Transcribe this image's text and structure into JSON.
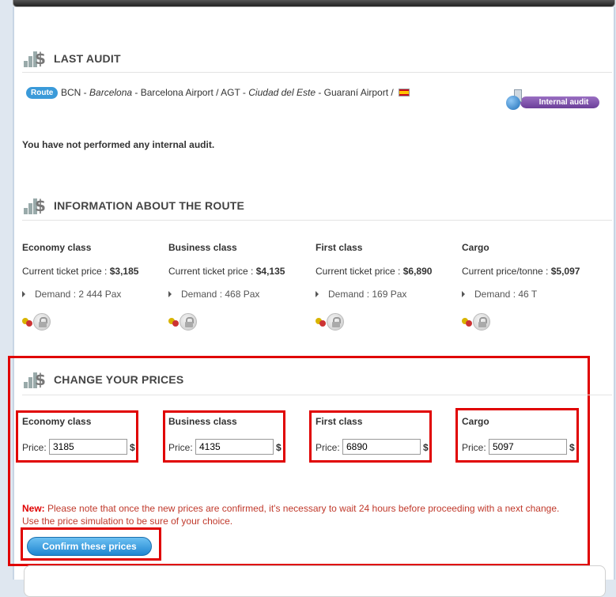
{
  "last_audit": {
    "title": "LAST AUDIT",
    "route_badge": "Route",
    "origin_code": "BCN",
    "origin_city": "Barcelona",
    "origin_airport": "Barcelona Airport",
    "dest_code": "AGT",
    "dest_city": "Ciudad del Este",
    "dest_airport": "Guaraní Airport",
    "internal_audit_button": "Internal audit",
    "no_audit_message": "You have not performed any internal audit."
  },
  "route_info": {
    "title": "INFORMATION ABOUT THE ROUTE",
    "columns": [
      {
        "name": "Economy class",
        "price_label": "Current ticket price :",
        "price": "$3,185",
        "demand": "Demand : 2 444 Pax"
      },
      {
        "name": "Business class",
        "price_label": "Current ticket price :",
        "price": "$4,135",
        "demand": "Demand : 468 Pax"
      },
      {
        "name": "First class",
        "price_label": "Current ticket price :",
        "price": "$6,890",
        "demand": "Demand : 169 Pax"
      },
      {
        "name": "Cargo",
        "price_label": "Current price/tonne :",
        "price": "$5,097",
        "demand": "Demand : 46 T"
      }
    ]
  },
  "change_prices": {
    "title": "CHANGE YOUR PRICES",
    "fields": [
      {
        "name": "Economy class",
        "label": "Price:",
        "value": "3185",
        "currency": "$"
      },
      {
        "name": "Business class",
        "label": "Price:",
        "value": "4135",
        "currency": "$"
      },
      {
        "name": "First class",
        "label": "Price:",
        "value": "6890",
        "currency": "$"
      },
      {
        "name": "Cargo",
        "label": "Price:",
        "value": "5097",
        "currency": "$"
      }
    ],
    "notice_prefix": "New:",
    "notice_line1": " Please note that once the new prices are confirmed, it's necessary to wait 24 hours before proceeding with a next change.",
    "notice_line2": "Use the price simulation to be sure of your choice.",
    "confirm_button": "Confirm these prices"
  },
  "colors": {
    "highlight": "#e00000",
    "accent_blue": "#1f86d1",
    "audit_purple": "#6b3f99",
    "notice_red": "#c0392b"
  }
}
